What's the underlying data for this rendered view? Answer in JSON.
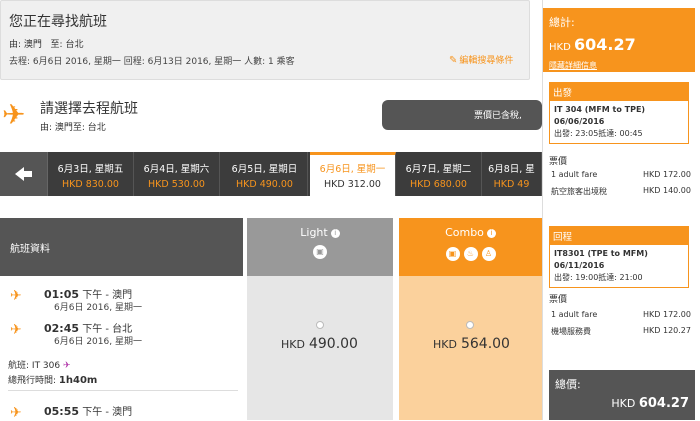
{
  "search": {
    "title": "您正在尋找航班",
    "route_from_label": "由:",
    "route_from": "澳門",
    "route_to_label": "至:",
    "route_to": "台北",
    "dates": "去程: 6月6日 2016, 星期一    回程: 6月13日 2016, 星期一    人數: 1 乘客",
    "edit_link": "編輯搜尋條件"
  },
  "choose": {
    "title": "請選擇去程航班",
    "route": "由: 澳門至: 台北",
    "fare_note": "票價已含稅,"
  },
  "date_tabs": [
    {
      "date": "6月3日, 星期五",
      "price": "HKD 830.00"
    },
    {
      "date": "6月4日, 星期六",
      "price": "HKD 530.00"
    },
    {
      "date": "6月5日, 星期日",
      "price": "HKD 490.00"
    },
    {
      "date": "6月6日, 星期一",
      "price": "HKD 312.00"
    },
    {
      "date": "6月7日, 星期二",
      "price": "HKD 680.00"
    },
    {
      "date": "6月8日, 星",
      "price": "HKD 49"
    }
  ],
  "columns": {
    "info_header": "航班資料",
    "light": "Light",
    "combo": "Combo"
  },
  "flight": {
    "dep_time": "01:05",
    "dep_suffix": "下午 - 澳門",
    "dep_date": "6月6日 2016, 星期一",
    "arr_time": "02:45",
    "arr_suffix": "下午 - 台北",
    "arr_date": "6月6日 2016, 星期一",
    "flight_no_label": "航班:",
    "flight_no": "IT 306",
    "duration_label": "總飛行時間:",
    "duration": "1h40m",
    "light_price": "490.00",
    "combo_price": "564.00",
    "currency": "HKD"
  },
  "flight2": {
    "dep_time": "05:55",
    "dep_suffix": "下午 - 澳門"
  },
  "sidebar": {
    "total_label": "總計:",
    "total_currency": "HKD",
    "total_amount": "604.27",
    "detail_link": "隱藏詳細信息",
    "outbound_header": "出發",
    "outbound_flight": "IT 304 (MFM to TPE)",
    "outbound_date": "06/06/2016",
    "outbound_times": "出發: 23:05抵達: 00:45",
    "fare_label": "票價",
    "out_fare_name": "1 adult fare",
    "out_fare_val": "HKD 172.00",
    "out_tax_name": "航空旅客出境稅",
    "out_tax_val": "HKD 140.00",
    "return_header": "回程",
    "return_flight": "IT8301 (TPE to MFM)",
    "return_date": "06/11/2016",
    "return_times": "出發: 19:00抵達: 21:00",
    "ret_fare_label": "票價",
    "ret_fare_name": "1 adult fare",
    "ret_fare_val": "HKD 172.00",
    "ret_tax_name": "機場服務費",
    "ret_tax_val": "HKD 120.27",
    "grand_label": "總價:",
    "grand_currency": "HKD",
    "grand_amount": "604.27"
  },
  "colors": {
    "accent": "#f7941d",
    "dark": "#3c3c3c",
    "grey": "#555555"
  }
}
